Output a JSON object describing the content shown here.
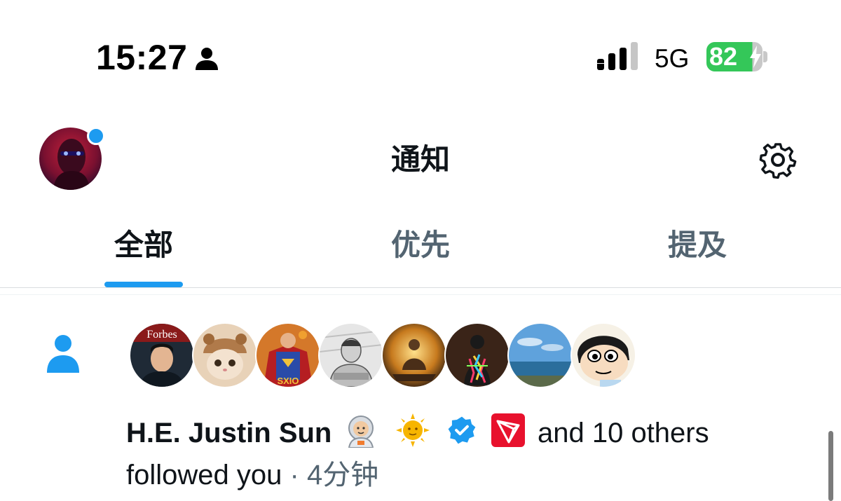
{
  "status_bar": {
    "time": "15:27",
    "network": "5G",
    "battery": "82",
    "battery_level": 0.82,
    "icons": [
      "person-icon",
      "signal-icon",
      "battery-icon",
      "bolt-icon"
    ]
  },
  "header": {
    "title": "通知",
    "icons": [
      "avatar",
      "gear-icon"
    ]
  },
  "tabs": [
    {
      "label": "全部",
      "active": true
    },
    {
      "label": "优先",
      "active": false
    },
    {
      "label": "提及",
      "active": false
    }
  ],
  "notification": {
    "icon": "person-follow-icon",
    "name": "H.E. Justin Sun",
    "rest": "and 10 others",
    "line2": "followed you",
    "separator": "·",
    "time": "4分钟",
    "emojis": [
      "astronaut-emoji",
      "sun-emoji",
      "verified-badge-icon",
      "tron-logo"
    ]
  },
  "colors": {
    "accent": "#1d9bf0",
    "text_primary": "#0f1419",
    "text_secondary": "#536471",
    "battery_green": "#34c759"
  }
}
